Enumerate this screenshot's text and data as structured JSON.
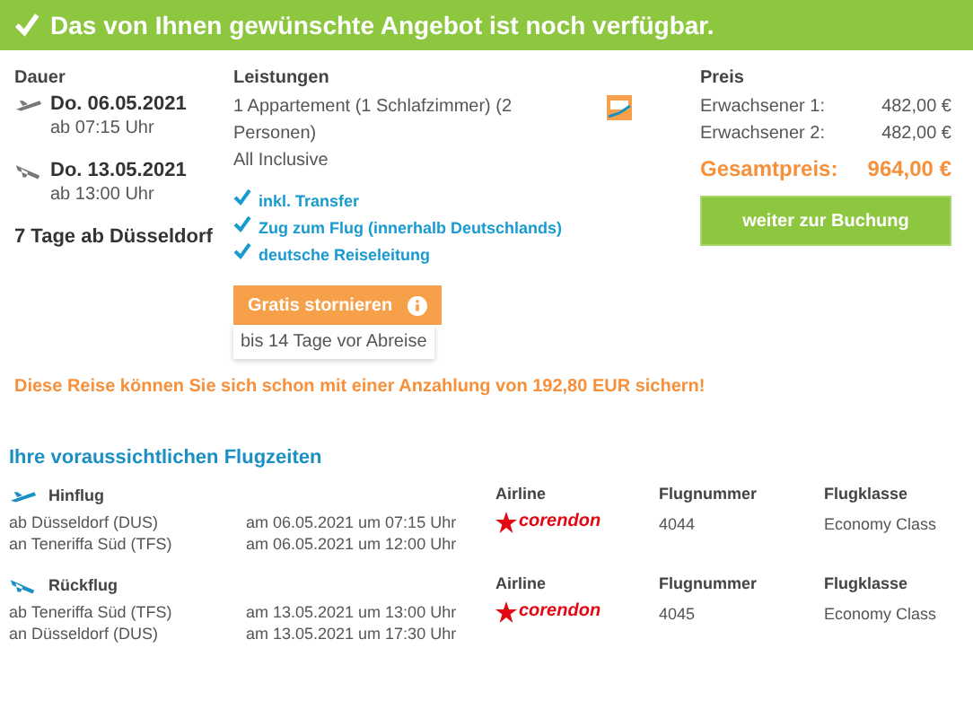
{
  "banner": {
    "text": "Das von Ihnen gewünschte Angebot ist noch verfügbar."
  },
  "duration": {
    "heading": "Dauer",
    "legs": [
      {
        "kind": "outbound",
        "date": "Do. 06.05.2021",
        "time": "ab 07:15 Uhr"
      },
      {
        "kind": "return",
        "date": "Do. 13.05.2021",
        "time": "ab 13:00 Uhr"
      }
    ],
    "summary": "7 Tage ab Düsseldorf"
  },
  "services": {
    "heading": "Leistungen",
    "room": "1 Appartement (1 Schlafzimmer) (2 Personen)",
    "board": "All Inclusive",
    "features": [
      "inkl. Transfer",
      "Zug zum Flug (innerhalb Deutschlands)",
      "deutsche Reiseleitung"
    ],
    "cancel_button": "Gratis stornieren",
    "cancel_note": "bis 14 Tage vor Abreise"
  },
  "price": {
    "heading": "Preis",
    "lines": [
      {
        "label": "Erwachsener 1:",
        "value": "482,00 €"
      },
      {
        "label": "Erwachsener 2:",
        "value": "482,00 €"
      }
    ],
    "total_label": "Gesamtpreis:",
    "total_value": "964,00 €",
    "book_button": "weiter zur Buchung"
  },
  "deposit_notice": "Diese Reise können Sie sich schon mit einer Anzahlung von 192,80 EUR sichern!",
  "flights": {
    "heading": "Ihre voraussichtlichen Flugzeiten",
    "legs": [
      {
        "kind": "outbound",
        "label": "Hinflug",
        "from": "ab Düsseldorf (DUS)",
        "to": "an Teneriffa Süd (TFS)",
        "dep": "am 06.05.2021 um 07:15 Uhr",
        "arr": "am 06.05.2021 um 12:00 Uhr",
        "airline_label": "Airline",
        "airline": "corendon",
        "number_label": "Flugnummer",
        "number": "4044",
        "class_label": "Flugklasse",
        "class": "Economy Class"
      },
      {
        "kind": "return",
        "label": "Rückflug",
        "from": "ab Teneriffa Süd (TFS)",
        "to": "an Düsseldorf (DUS)",
        "dep": "am 13.05.2021 um 13:00 Uhr",
        "arr": "am 13.05.2021 um 17:30 Uhr",
        "airline_label": "Airline",
        "airline": "corendon",
        "number_label": "Flugnummer",
        "number": "4045",
        "class_label": "Flugklasse",
        "class": "Economy Class"
      }
    ]
  }
}
